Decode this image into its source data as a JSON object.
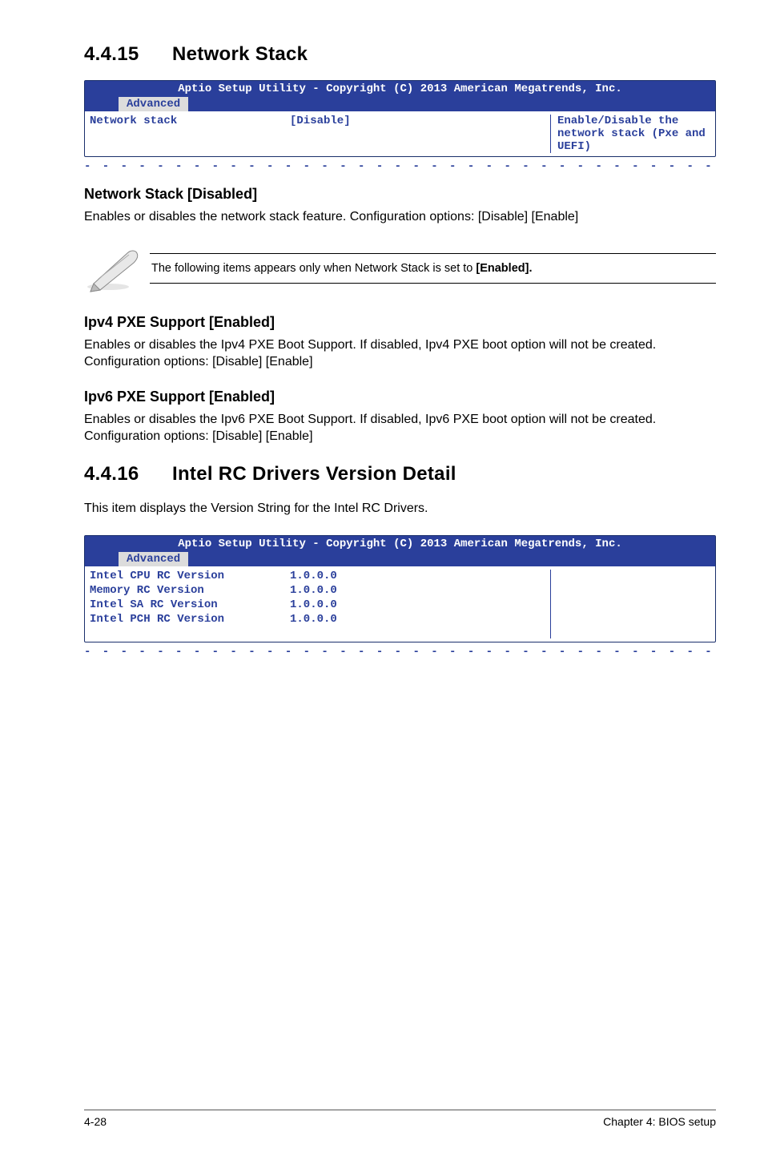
{
  "section1": {
    "num": "4.4.15",
    "title": "Network Stack",
    "bios": {
      "copyright": "Aptio Setup Utility - Copyright (C) 2013 American Megatrends, Inc.",
      "tab": "Advanced",
      "row_label": "Network stack",
      "row_value": "[Disable]",
      "help": "Enable/Disable the network stack (Pxe and UEFI)"
    },
    "sub1": {
      "head": "Network Stack [Disabled]",
      "body": "Enables or disables the network stack feature. Configuration options: [Disable] [Enable]"
    },
    "note": {
      "prefix": "The following items appears only when Network Stack is set to ",
      "bold": "[Enabled]."
    },
    "sub2": {
      "head": "Ipv4 PXE Support [Enabled]",
      "body": "Enables or disables the Ipv4 PXE Boot Support. If disabled, Ipv4 PXE boot option will not be created. Configuration options: [Disable] [Enable]"
    },
    "sub3": {
      "head": "Ipv6 PXE Support [Enabled]",
      "body": "Enables or disables the Ipv6 PXE Boot Support. If disabled, Ipv6 PXE boot option will not be created. Configuration options: [Disable] [Enable]"
    }
  },
  "section2": {
    "num": "4.4.16",
    "title": "Intel RC Drivers Version Detail",
    "intro": "This item displays the Version String for the Intel RC Drivers.",
    "bios": {
      "copyright": "Aptio Setup Utility - Copyright (C) 2013 American Megatrends, Inc.",
      "tab": "Advanced",
      "rows": [
        {
          "label": "Intel CPU RC Version",
          "value": "1.0.0.0"
        },
        {
          "label": "Memory RC Version",
          "value": "1.0.0.0"
        },
        {
          "label": "Intel SA RC Version",
          "value": "1.0.0.0"
        },
        {
          "label": "Intel PCH RC Version",
          "value": "1.0.0.0"
        }
      ]
    }
  },
  "footer": {
    "left": "4-28",
    "right": "Chapter 4: BIOS setup"
  },
  "dashline": "- - - - - - - - - - - - - - - - - - - - - - - - - - - - - - - - - - - - - - - - - - - - - - - - - - - - -"
}
